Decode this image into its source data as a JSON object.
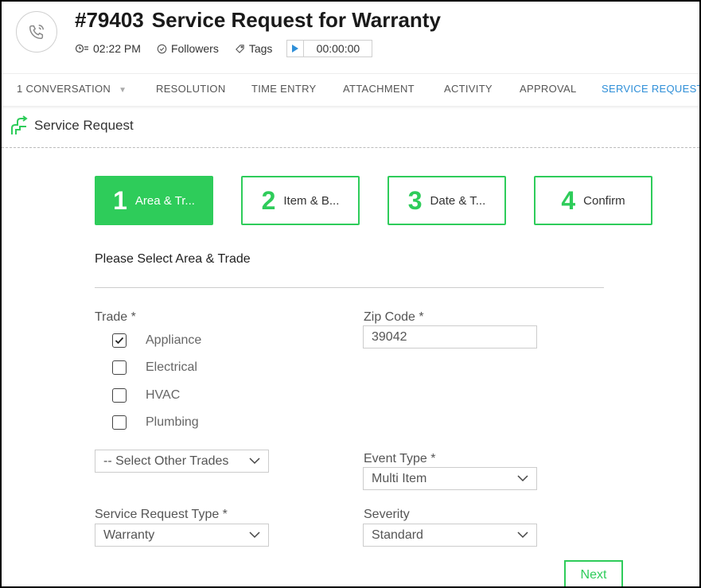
{
  "header": {
    "ticket_number": "#79403",
    "title": "Service Request for Warranty",
    "time": "02:22 PM",
    "followers": "Followers",
    "tags": "Tags",
    "timer": "00:00:00"
  },
  "tabs": [
    {
      "label": "1 CONVERSATION"
    },
    {
      "label": "RESOLUTION"
    },
    {
      "label": "TIME ENTRY"
    },
    {
      "label": "ATTACHMENT"
    },
    {
      "label": "ACTIVITY"
    },
    {
      "label": "APPROVAL"
    },
    {
      "label": "SERVICE REQUEST",
      "active": true
    }
  ],
  "section": {
    "title": "Service Request"
  },
  "steps": [
    {
      "number": "1",
      "label": "Area & Tr...",
      "active": true
    },
    {
      "number": "2",
      "label": "Item & B..."
    },
    {
      "number": "3",
      "label": "Date & T..."
    },
    {
      "number": "4",
      "label": "Confirm"
    }
  ],
  "form": {
    "title": "Please Select Area & Trade",
    "trade_label": "Trade *",
    "trades": [
      {
        "label": "Appliance",
        "checked": true
      },
      {
        "label": "Electrical",
        "checked": false
      },
      {
        "label": "HVAC",
        "checked": false
      },
      {
        "label": "Plumbing",
        "checked": false
      }
    ],
    "other_trades": "-- Select Other Trades",
    "zip_label": "Zip Code *",
    "zip_value": "39042",
    "event_type_label": "Event Type *",
    "event_type_value": "Multi Item",
    "service_request_type_label": "Service Request Type *",
    "service_request_type_value": "Warranty",
    "severity_label": "Severity",
    "severity_value": "Standard",
    "next_label": "Next"
  },
  "colors": {
    "accent_green": "#2ecc5a",
    "active_tab": "#2f8fd8"
  }
}
